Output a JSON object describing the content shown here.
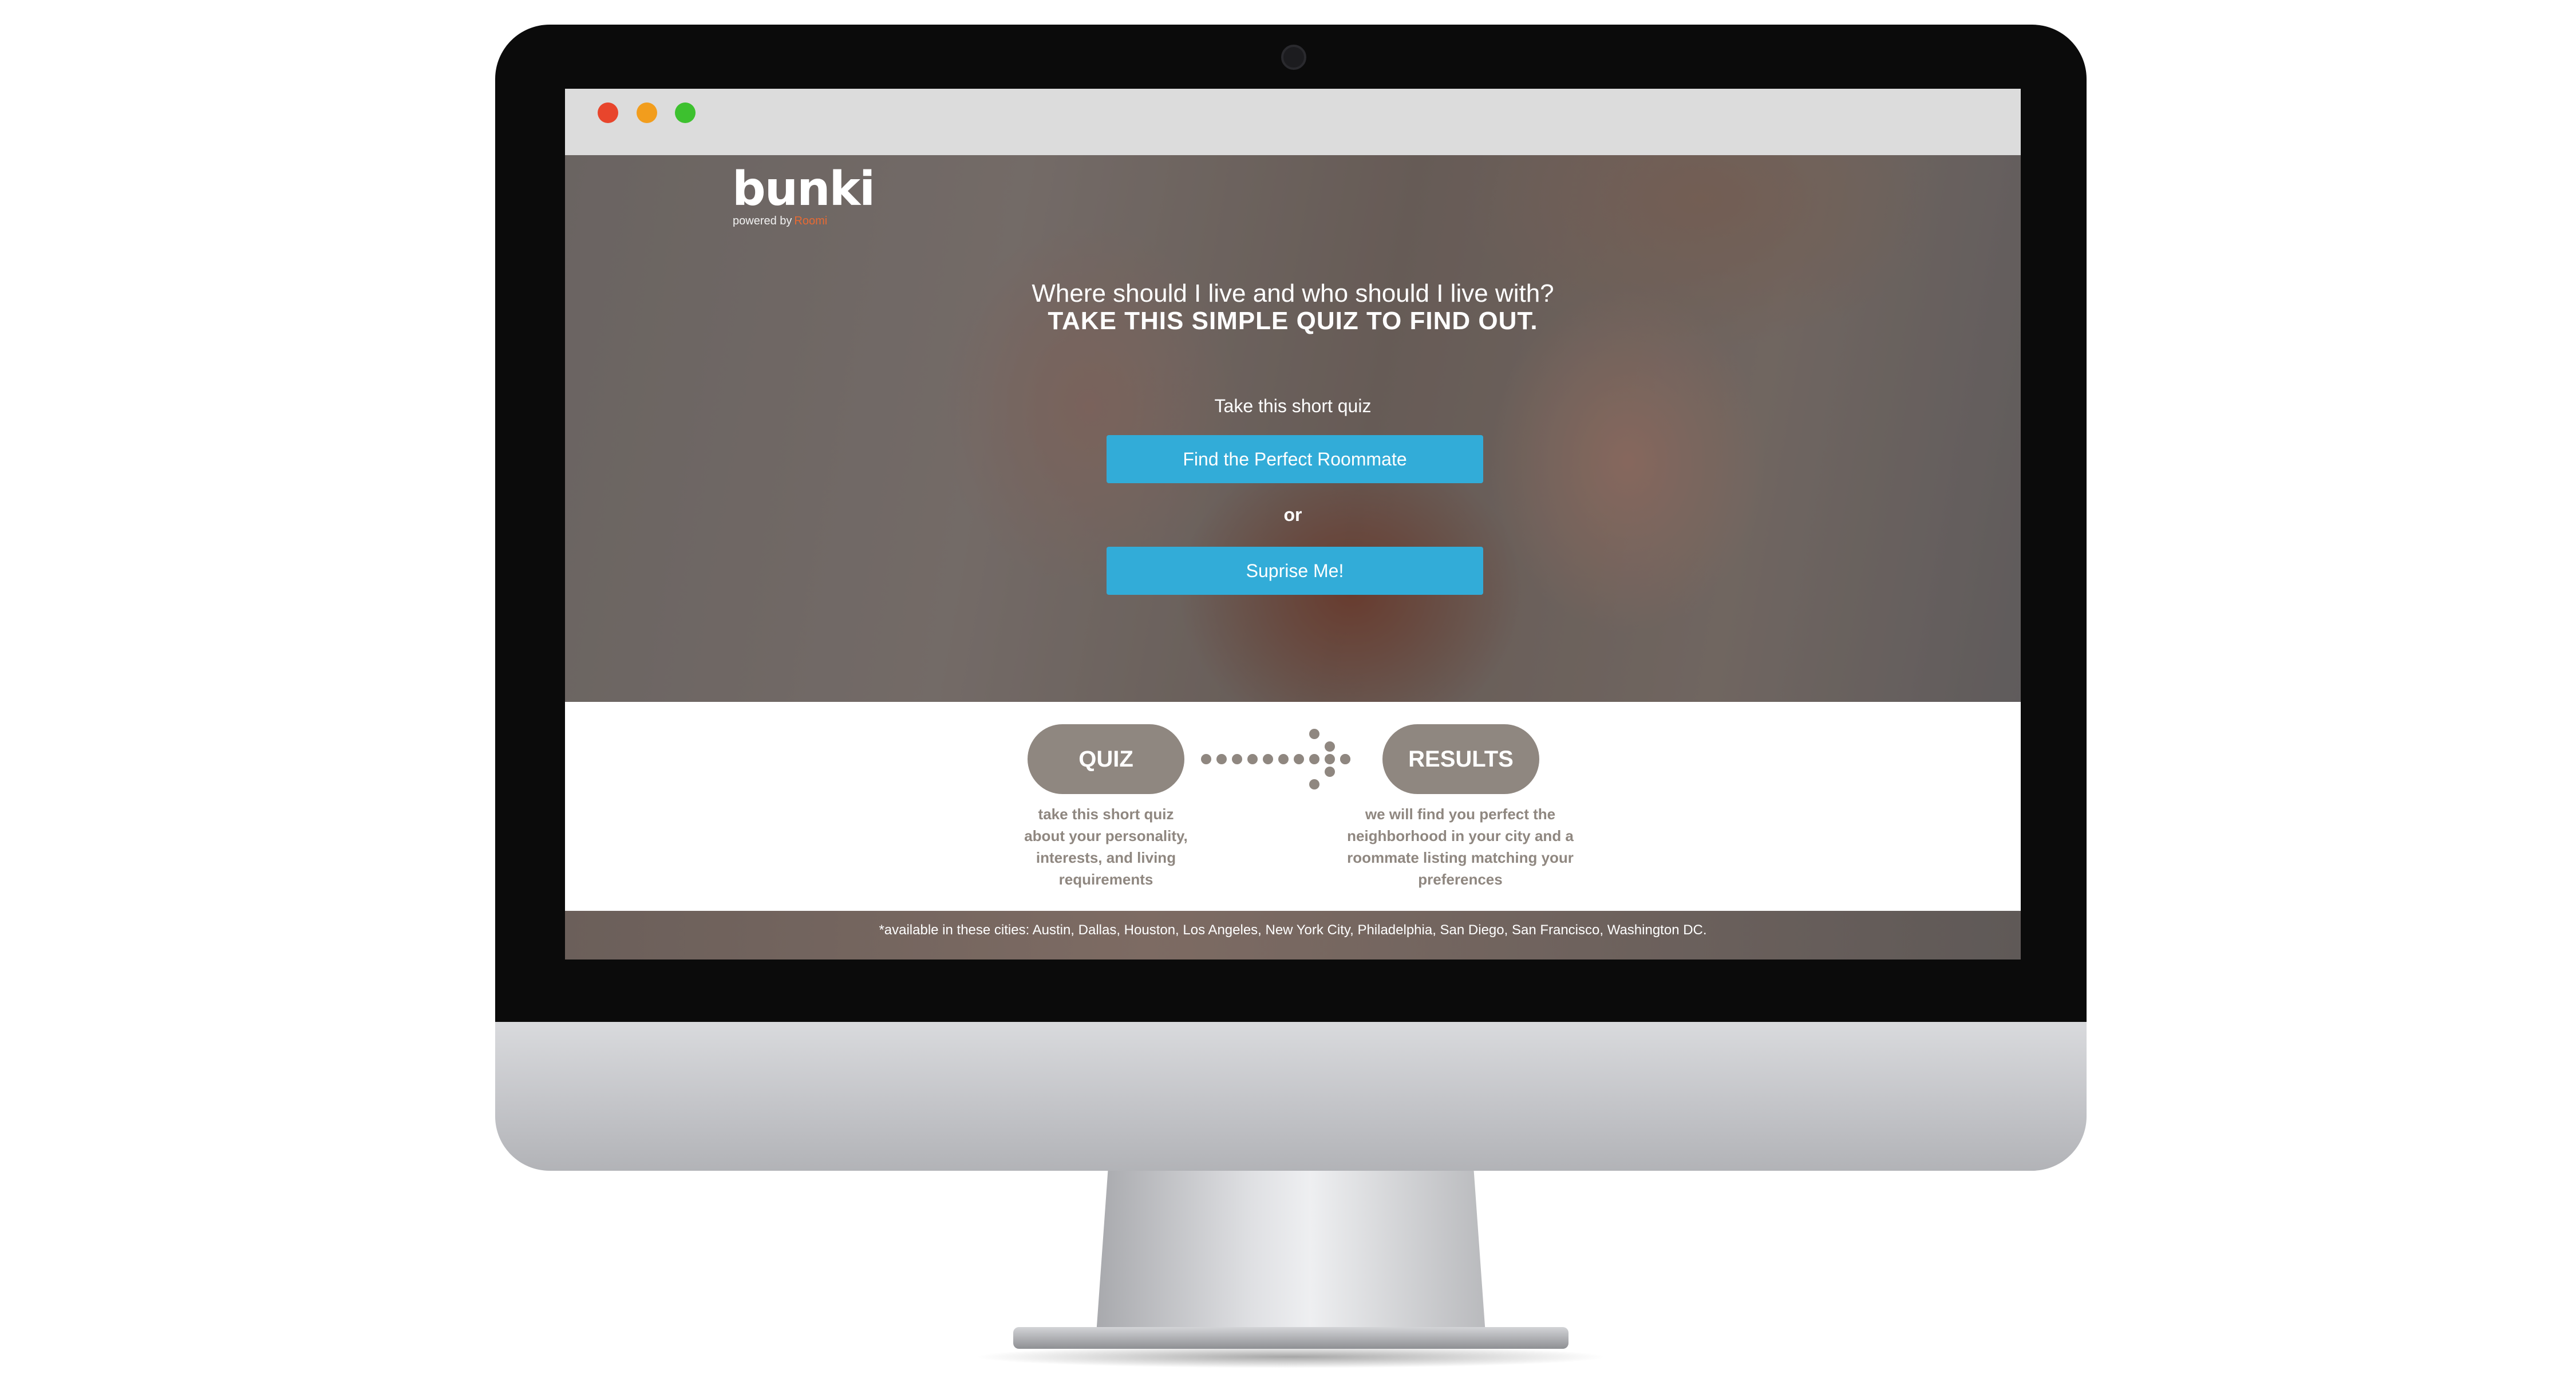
{
  "brand": {
    "logo": "bunki",
    "tagline": "powered by",
    "partner": "Roomi"
  },
  "hero": {
    "question": "Where should I live and who should I live with?",
    "headline": "TAKE THIS SIMPLE QUIZ TO FIND OUT.",
    "prompt": "Take this short quiz",
    "primary_button": "Find the Perfect Roommate",
    "or_label": "or",
    "secondary_button": "Suprise Me!"
  },
  "steps": {
    "quiz": {
      "label": "QUIZ",
      "description": "take this short quiz about your personality, interests, and living requirements"
    },
    "results": {
      "label": "RESULTS",
      "description": "we will find you perfect the neighborhood in your city and a roommate listing matching your preferences"
    }
  },
  "footer": {
    "cities_note": "*available in these cities: Austin, Dallas, Houston, Los Angeles, New York City, Philadelphia, San Diego, San Francisco, Washington DC."
  },
  "colors": {
    "button": "#32acd8",
    "pill": "#8f8780",
    "partner_orange": "#e86a33"
  }
}
